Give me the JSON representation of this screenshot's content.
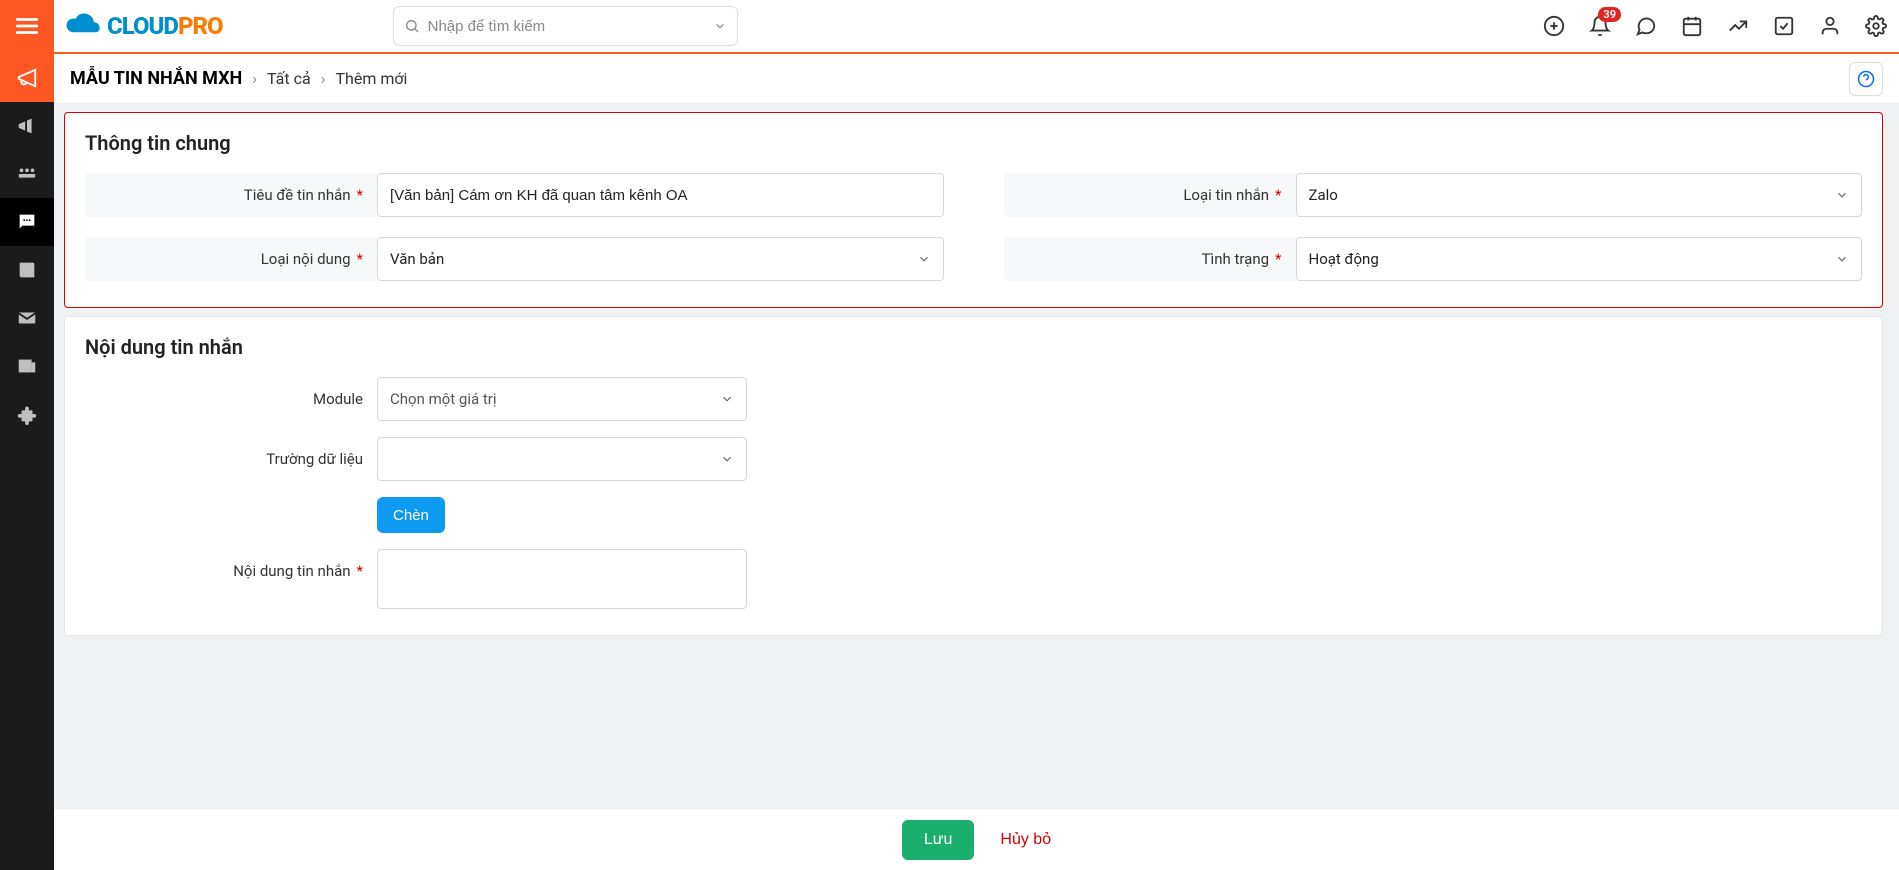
{
  "topbar": {
    "search_placeholder": "Nhập để tìm kiếm",
    "notif_count": "39"
  },
  "breadcrumb": {
    "module": "MẪU TIN NHẮN MXH",
    "level1": "Tất cả",
    "level2": "Thêm mới"
  },
  "panel_general": {
    "title": "Thông tin chung",
    "labels": {
      "message_title": "Tiêu đề tin nhắn",
      "message_type": "Loại tin nhắn",
      "content_type": "Loại nội dung",
      "status": "Tình trạng"
    },
    "values": {
      "message_title": "[Văn bản] Cám ơn KH đã quan tâm kênh OA",
      "message_type": "Zalo",
      "content_type": "Văn bản",
      "status": "Hoạt động"
    }
  },
  "panel_content": {
    "title": "Nội dung tin nhắn",
    "labels": {
      "module": "Module",
      "field": "Trường dữ liệu",
      "body": "Nội dung tin nhắn"
    },
    "values": {
      "module_placeholder": "Chọn một giá trị",
      "field_value": "",
      "body_value": ""
    },
    "insert_button": "Chèn"
  },
  "footer": {
    "save": "Lưu",
    "cancel": "Hủy bỏ"
  }
}
